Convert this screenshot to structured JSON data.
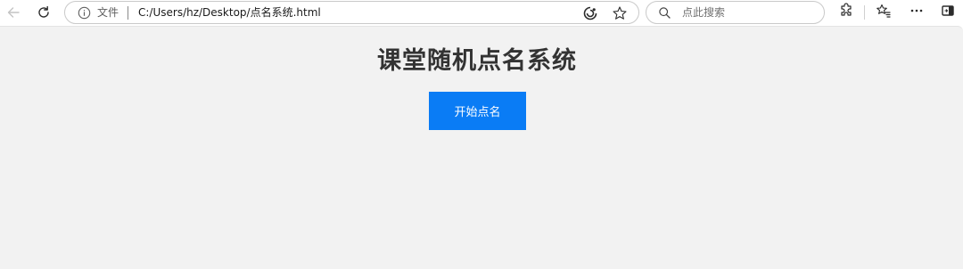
{
  "browser": {
    "site_info_label": "文件",
    "url": "C:/Users/hz/Desktop/点名系统.html",
    "search": {
      "placeholder": "点此搜索"
    },
    "icons": [
      "back-icon",
      "refresh-icon",
      "info-icon",
      "read-aloud-icon",
      "favorite-star-icon",
      "search-icon",
      "extensions-icon",
      "favorites-icon",
      "more-icon",
      "sidebar-icon"
    ]
  },
  "page": {
    "title": "课堂随机点名系统",
    "start_button_label": "开始点名",
    "colors": {
      "background": "#f2f2f2",
      "button": "#0a7cf5",
      "title": "#333333"
    }
  }
}
